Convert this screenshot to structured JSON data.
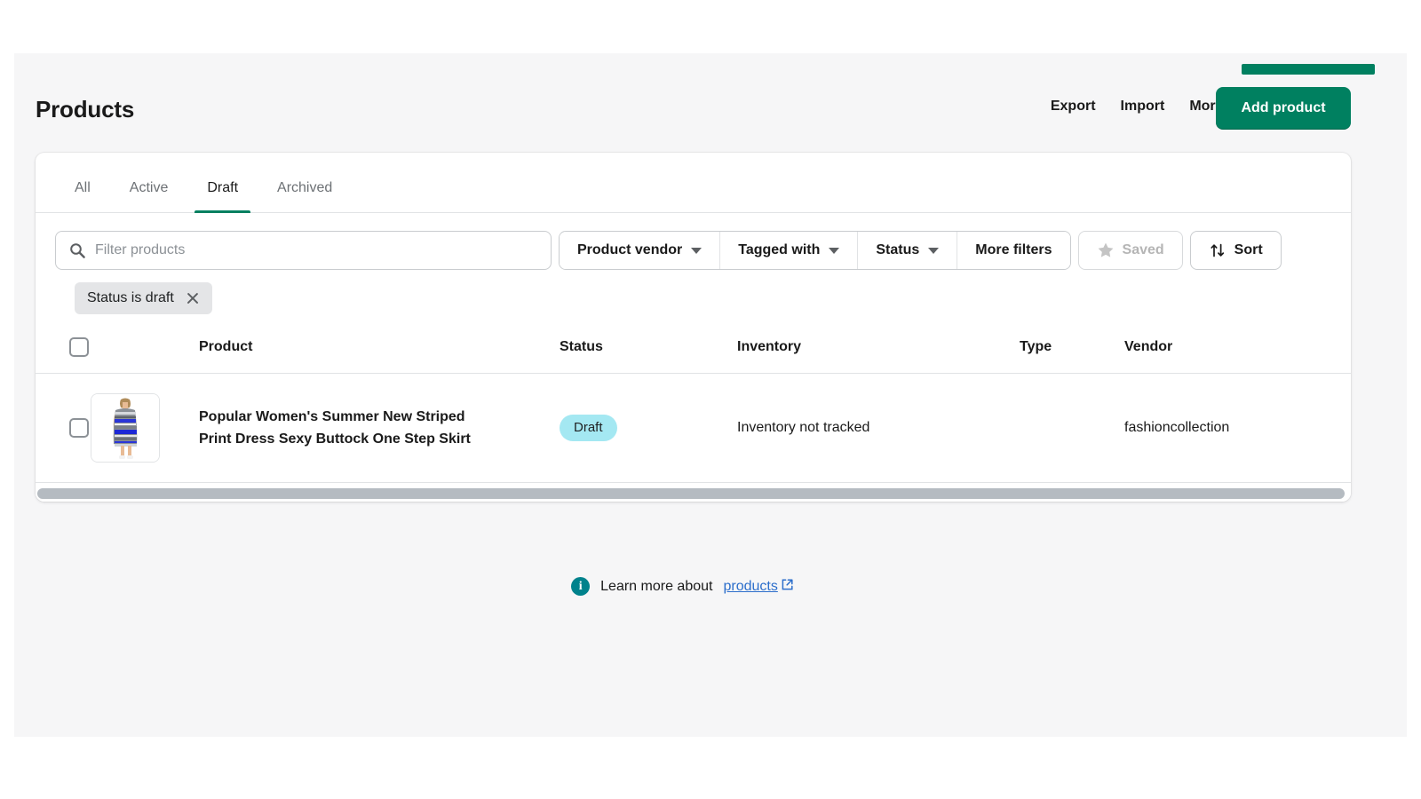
{
  "header": {
    "title": "Products",
    "actions": [
      {
        "label": "Export",
        "name": "export-button"
      },
      {
        "label": "Import",
        "name": "import-button"
      },
      {
        "label": "More actions",
        "name": "more-actions-button",
        "caret": true
      }
    ],
    "primary_action": {
      "label": "Add product"
    },
    "progress_bar_color": "#008060"
  },
  "tabs": [
    {
      "label": "All",
      "active": false
    },
    {
      "label": "Active",
      "active": false
    },
    {
      "label": "Draft",
      "active": true
    },
    {
      "label": "Archived",
      "active": false
    }
  ],
  "filters": {
    "search": {
      "placeholder": "Filter products",
      "value": ""
    },
    "segmented": [
      {
        "label": "Product vendor",
        "caret": true
      },
      {
        "label": "Tagged with",
        "caret": true
      },
      {
        "label": "Status",
        "caret": true
      },
      {
        "label": "More filters",
        "caret": false
      }
    ],
    "saved_button": {
      "label": "Saved",
      "disabled": true
    },
    "sort_button": {
      "label": "Sort"
    },
    "applied": [
      {
        "label": "Status is draft"
      }
    ]
  },
  "table": {
    "columns": [
      "Product",
      "Status",
      "Inventory",
      "Type",
      "Vendor"
    ],
    "rows": [
      {
        "product": "Popular Women's Summer New Striped Print Dress Sexy Buttock One Step Skirt",
        "status": "Draft",
        "status_color": "#a4e8f2",
        "inventory": "Inventory not tracked",
        "type": "",
        "vendor": "fashioncollection",
        "thumb_alt": "striped-dress-photo"
      }
    ]
  },
  "footer": {
    "info_glyph": "i",
    "text": "Learn more about",
    "link": "products"
  },
  "colors": {
    "brand_green": "#008060",
    "page_bg": "#f6f6f7",
    "card_bg": "#ffffff",
    "link_blue": "#2c6ecb",
    "info_teal": "#00828c"
  }
}
